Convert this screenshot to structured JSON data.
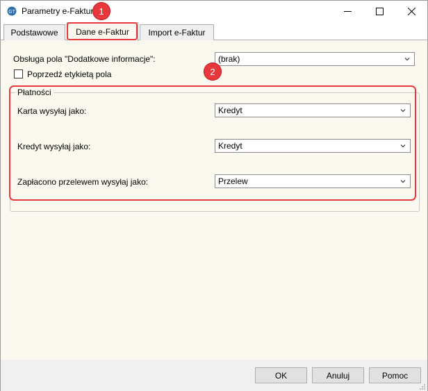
{
  "window": {
    "title": "Parametry e-Faktur",
    "icon": "app-logo-icon",
    "controls": {
      "minimize": "minimize-icon",
      "maximize": "maximize-icon",
      "close": "close-icon"
    }
  },
  "annotations": {
    "badge1": "1",
    "badge2": "2",
    "color": "#e8383d"
  },
  "tabs": [
    {
      "label": "Podstawowe",
      "active": false
    },
    {
      "label": "Dane e-Faktur",
      "active": true
    },
    {
      "label": "Import e-Faktur",
      "active": false
    }
  ],
  "main": {
    "extra_info_label": "Obsługa pola \"Dodatkowe informacje\":",
    "extra_info_value": "(brak)",
    "prepend_label_text": "Poprzedź etykietą pola",
    "prepend_label_checked": false
  },
  "payments": {
    "group_title": "Płatności",
    "rows": [
      {
        "label": "Karta wysyłaj jako:",
        "value": "Kredyt"
      },
      {
        "label": "Kredyt wysyłaj jako:",
        "value": "Kredyt"
      },
      {
        "label": "Zapłacono przelewem wysyłaj jako:",
        "value": "Przelew"
      }
    ]
  },
  "buttons": {
    "ok": "OK",
    "cancel": "Anuluj",
    "help": "Pomoc"
  },
  "colors": {
    "dialog_bg": "#fbf9ef",
    "highlight": "#e8383d"
  }
}
